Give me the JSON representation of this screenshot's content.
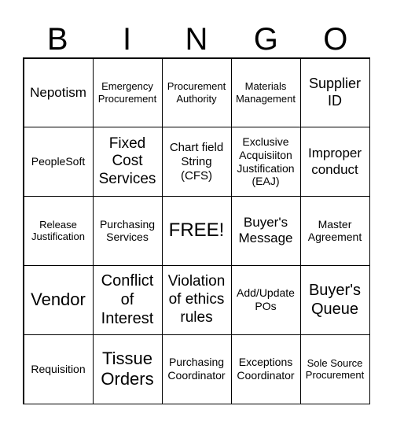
{
  "header": [
    "B",
    "I",
    "N",
    "G",
    "O"
  ],
  "cells": [
    {
      "text": "Nepotism",
      "size": 17
    },
    {
      "text": "Emergency Procurement",
      "size": 13
    },
    {
      "text": "Procurement Authority",
      "size": 13
    },
    {
      "text": "Materials Management",
      "size": 13
    },
    {
      "text": "Supplier ID",
      "size": 18
    },
    {
      "text": "PeopleSoft",
      "size": 14
    },
    {
      "text": "Fixed Cost Services",
      "size": 19
    },
    {
      "text": "Chart field String (CFS)",
      "size": 15
    },
    {
      "text": "Exclusive Acquisiiton Justification (EAJ)",
      "size": 14
    },
    {
      "text": "Improper conduct",
      "size": 17
    },
    {
      "text": "Release Justification",
      "size": 13
    },
    {
      "text": "Purchasing Services",
      "size": 14
    },
    {
      "text": "FREE!",
      "size": 24
    },
    {
      "text": "Buyer's Message",
      "size": 17
    },
    {
      "text": "Master Agreement",
      "size": 14
    },
    {
      "text": "Vendor",
      "size": 22
    },
    {
      "text": "Conflict of Interest",
      "size": 20
    },
    {
      "text": "Violation of ethics rules",
      "size": 19
    },
    {
      "text": "Add/Update POs",
      "size": 14
    },
    {
      "text": "Buyer's Queue",
      "size": 20
    },
    {
      "text": "Requisition",
      "size": 14
    },
    {
      "text": "Tissue Orders",
      "size": 22
    },
    {
      "text": "Purchasing Coordinator",
      "size": 14
    },
    {
      "text": "Exceptions Coordinator",
      "size": 14
    },
    {
      "text": "Sole Source Procurement",
      "size": 13
    }
  ]
}
